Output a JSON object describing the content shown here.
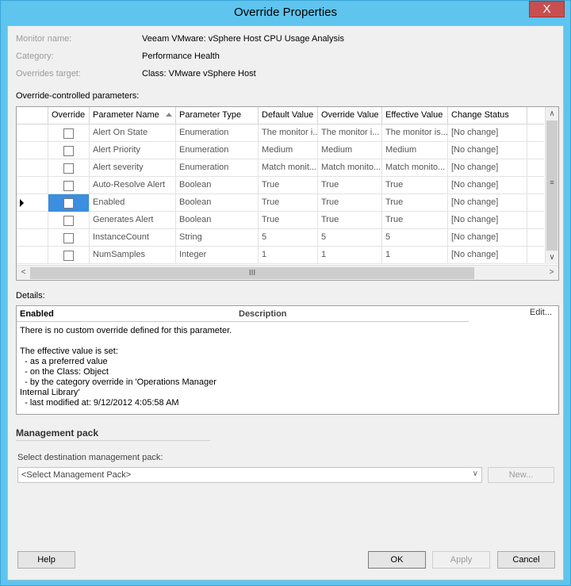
{
  "window": {
    "title": "Override Properties",
    "close_glyph": "X"
  },
  "info": [
    {
      "label": "Monitor name:",
      "value": "Veeam VMware: vSphere Host CPU Usage Analysis"
    },
    {
      "label": "Category:",
      "value": "Performance Health"
    },
    {
      "label": "Overrides target:",
      "value": "Class: VMware vSphere Host"
    }
  ],
  "grid": {
    "section_label": "Override-controlled parameters:",
    "columns": [
      "Override",
      "Parameter Name",
      "Parameter Type",
      "Default Value",
      "Override Value",
      "Effective Value",
      "Change Status"
    ],
    "sort_column": "Parameter Name",
    "selected_row_index": 4,
    "rows": [
      {
        "name": "Alert On State",
        "type": "Enumeration",
        "default": "The monitor i...",
        "override": "The monitor i...",
        "effective": "The monitor is...",
        "status": "[No change]"
      },
      {
        "name": "Alert Priority",
        "type": "Enumeration",
        "default": "Medium",
        "override": "Medium",
        "effective": "Medium",
        "status": "[No change]"
      },
      {
        "name": "Alert severity",
        "type": "Enumeration",
        "default": "Match monit...",
        "override": "Match monito...",
        "effective": "Match monito...",
        "status": "[No change]"
      },
      {
        "name": "Auto-Resolve Alert",
        "type": "Boolean",
        "default": "True",
        "override": "True",
        "effective": "True",
        "status": "[No change]"
      },
      {
        "name": "Enabled",
        "type": "Boolean",
        "default": "True",
        "override": "True",
        "effective": "True",
        "status": "[No change]"
      },
      {
        "name": "Generates Alert",
        "type": "Boolean",
        "default": "True",
        "override": "True",
        "effective": "True",
        "status": "[No change]"
      },
      {
        "name": "InstanceCount",
        "type": "String",
        "default": "5",
        "override": "5",
        "effective": "5",
        "status": "[No change]"
      },
      {
        "name": "NumSamples",
        "type": "Integer",
        "default": "1",
        "override": "1",
        "effective": "1",
        "status": "[No change]"
      }
    ]
  },
  "details": {
    "section_label": "Details:",
    "name": "Enabled",
    "description_header": "Description",
    "edit_label": "Edit...",
    "body": "There is no custom override defined for this parameter.\n\nThe effective value is set:\n  - as a preferred value\n  - on the Class: Object\n  - by the category override in 'Operations Manager\nInternal Library'\n  - last modified at: 9/12/2012 4:05:58 AM"
  },
  "management_pack": {
    "header": "Management pack",
    "select_label": "Select destination management pack:",
    "select_value": "<Select Management Pack>",
    "new_button": "New..."
  },
  "buttons": {
    "help": "Help",
    "ok": "OK",
    "apply": "Apply",
    "cancel": "Cancel"
  },
  "icons": {
    "sort": "sort-ascending-icon",
    "row_pointer": "current-row-icon",
    "scroll_up": "∧",
    "scroll_down": "∨",
    "scroll_left": "<",
    "scroll_right": ">",
    "vertical_grip": "≡",
    "horizontal_grip": "III",
    "dropdown": "∨"
  }
}
